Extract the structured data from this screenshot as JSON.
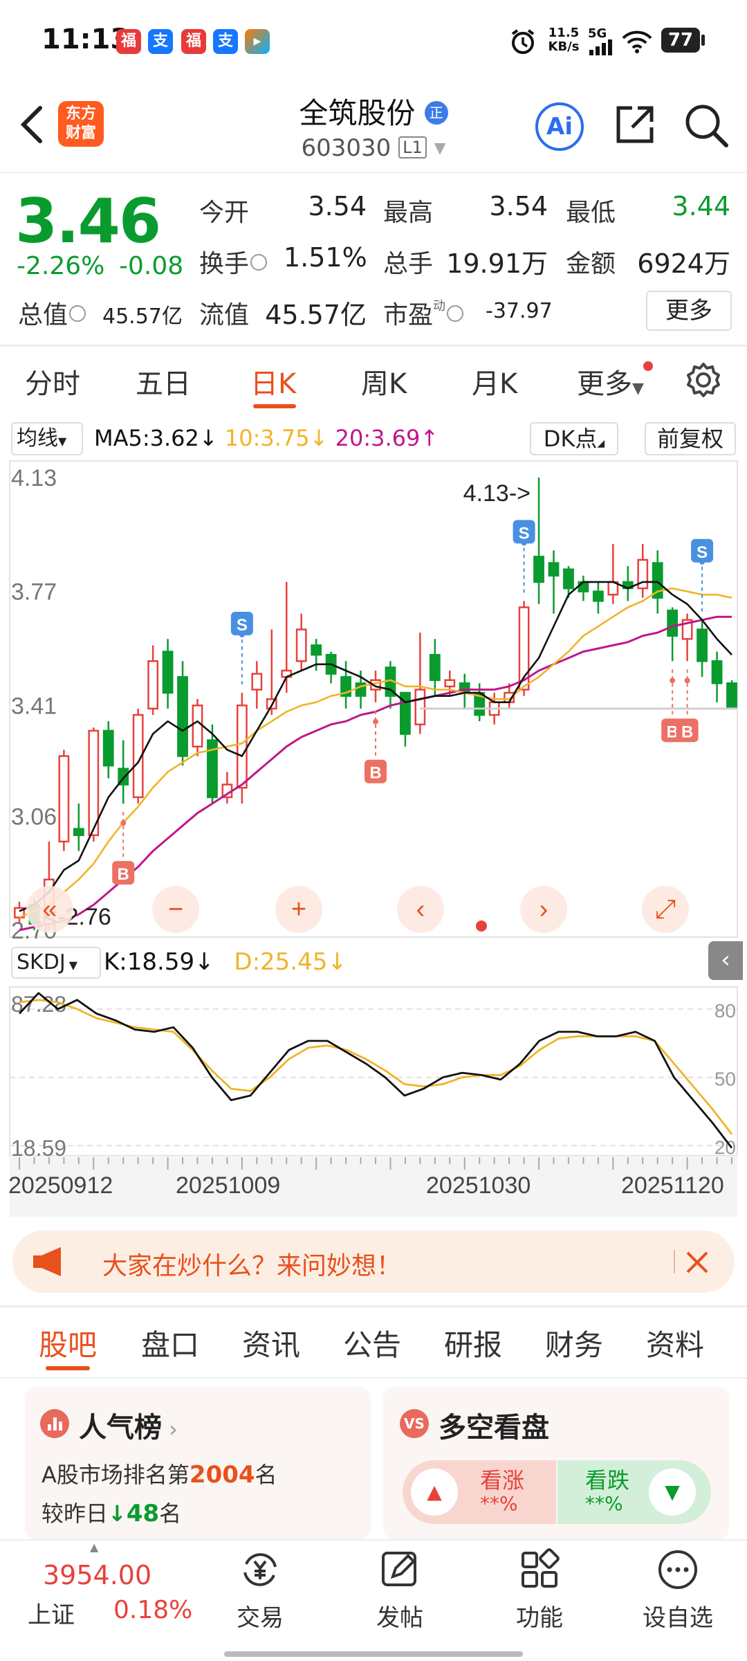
{
  "status_bar": {
    "time": "11:13",
    "net_speed_value": "11.5",
    "net_speed_unit": "KB/s",
    "network": "5G",
    "battery": "77"
  },
  "header": {
    "stock_name": "全筑股份",
    "name_badge": "正",
    "stock_code": "603030",
    "level_badge": "L1",
    "logo_line1": "东方",
    "logo_line2": "财富",
    "ai_label": "Ai"
  },
  "quote": {
    "price": "3.46",
    "change_pct": "-2.26%",
    "change_abs": "-0.08",
    "open_label": "今开",
    "open_value": "3.54",
    "high_label": "最高",
    "high_value": "3.54",
    "low_label": "最低",
    "low_value": "3.44",
    "turnover_label": "换手",
    "turnover_value": "1.51%",
    "volume_label": "总手",
    "volume_value": "19.91万",
    "amount_label": "金额",
    "amount_value": "6924万",
    "mktcap_label": "总值",
    "mktcap_value": "45.57亿",
    "float_label": "流值",
    "float_value": "45.57亿",
    "pe_label": "市盈",
    "pe_sup": "动",
    "pe_value": "-37.97",
    "more_label": "更多"
  },
  "period_tabs": {
    "items": [
      "分时",
      "五日",
      "日K",
      "周K",
      "月K",
      "更多"
    ],
    "active_index": 2
  },
  "kline_toolbar": {
    "indicator_select": "均线",
    "ma5": "MA5:3.62",
    "ma10": "10:3.75",
    "ma20": "20:3.69",
    "dk_label": "DK点",
    "adjust_label": "前复权"
  },
  "colors": {
    "up": "#e8413c",
    "down": "#0a9b2e",
    "accent": "#e8501c",
    "ma5": "#111111",
    "ma10": "#f0b429",
    "ma20": "#c0168c",
    "k_line": "#111111",
    "d_line": "#f0b429"
  },
  "chart_data": [
    {
      "type": "candlestick",
      "y_ticks": [
        "4.13",
        "3.77",
        "3.41",
        "3.06",
        "2.70"
      ],
      "ylim": [
        2.7,
        4.13
      ],
      "max_annotation": "4.13->",
      "min_annotation": "<-2.76",
      "candles": [
        [
          2.74,
          2.77,
          2.72,
          2.79
        ],
        [
          2.78,
          2.72,
          2.7,
          2.8
        ],
        [
          2.72,
          2.86,
          2.7,
          2.98
        ],
        [
          2.98,
          3.25,
          2.95,
          3.27
        ],
        [
          3.02,
          3.0,
          2.95,
          3.1
        ],
        [
          3.0,
          3.33,
          2.98,
          3.34
        ],
        [
          3.33,
          3.22,
          3.18,
          3.36
        ],
        [
          3.21,
          3.16,
          3.1,
          3.3
        ],
        [
          3.12,
          3.38,
          3.1,
          3.4
        ],
        [
          3.4,
          3.55,
          3.38,
          3.6
        ],
        [
          3.58,
          3.45,
          3.4,
          3.62
        ],
        [
          3.5,
          3.25,
          3.22,
          3.55
        ],
        [
          3.28,
          3.41,
          3.25,
          3.43
        ],
        [
          3.3,
          3.12,
          3.1,
          3.35
        ],
        [
          3.12,
          3.16,
          3.1,
          3.2
        ],
        [
          3.15,
          3.41,
          3.1,
          3.45
        ],
        [
          3.46,
          3.51,
          3.4,
          3.55
        ],
        [
          3.4,
          3.43,
          3.38,
          3.65
        ],
        [
          3.5,
          3.52,
          3.45,
          3.8
        ],
        [
          3.55,
          3.65,
          3.52,
          3.7
        ],
        [
          3.6,
          3.57,
          3.52,
          3.62
        ],
        [
          3.57,
          3.51,
          3.48,
          3.58
        ],
        [
          3.5,
          3.44,
          3.4,
          3.55
        ],
        [
          3.48,
          3.44,
          3.4,
          3.52
        ],
        [
          3.46,
          3.49,
          3.42,
          3.52
        ],
        [
          3.53,
          3.44,
          3.4,
          3.55
        ],
        [
          3.45,
          3.32,
          3.28,
          3.45
        ],
        [
          3.35,
          3.46,
          3.32,
          3.64
        ],
        [
          3.57,
          3.49,
          3.44,
          3.62
        ],
        [
          3.47,
          3.49,
          3.44,
          3.52
        ],
        [
          3.48,
          3.45,
          3.4,
          3.51
        ],
        [
          3.45,
          3.38,
          3.36,
          3.48
        ],
        [
          3.38,
          3.42,
          3.35,
          3.45
        ],
        [
          3.42,
          3.45,
          3.4,
          3.48
        ],
        [
          3.46,
          3.72,
          3.44,
          3.74
        ],
        [
          3.88,
          3.8,
          3.73,
          4.13
        ],
        [
          3.86,
          3.82,
          3.7,
          3.9
        ],
        [
          3.84,
          3.78,
          3.75,
          3.85
        ],
        [
          3.8,
          3.77,
          3.74,
          3.82
        ],
        [
          3.77,
          3.74,
          3.7,
          3.8
        ],
        [
          3.76,
          3.8,
          3.73,
          3.92
        ],
        [
          3.8,
          3.78,
          3.74,
          3.85
        ],
        [
          3.78,
          3.87,
          3.75,
          3.92
        ],
        [
          3.86,
          3.75,
          3.7,
          3.9
        ],
        [
          3.71,
          3.63,
          3.55,
          3.72
        ],
        [
          3.62,
          3.68,
          3.55,
          3.7
        ],
        [
          3.65,
          3.55,
          3.5,
          3.68
        ],
        [
          3.55,
          3.48,
          3.42,
          3.58
        ],
        [
          3.48,
          3.4,
          3.4,
          3.49
        ]
      ],
      "ma5": [
        2.76,
        2.78,
        2.82,
        2.89,
        2.92,
        3.02,
        3.12,
        3.18,
        3.23,
        3.32,
        3.36,
        3.33,
        3.36,
        3.32,
        3.27,
        3.25,
        3.33,
        3.41,
        3.5,
        3.52,
        3.54,
        3.54,
        3.52,
        3.5,
        3.47,
        3.46,
        3.42,
        3.43,
        3.44,
        3.44,
        3.45,
        3.45,
        3.42,
        3.42,
        3.5,
        3.56,
        3.66,
        3.76,
        3.8,
        3.8,
        3.8,
        3.78,
        3.8,
        3.8,
        3.76,
        3.73,
        3.68,
        3.62,
        3.57
      ],
      "ma10": [
        2.74,
        2.76,
        2.78,
        2.82,
        2.86,
        2.91,
        2.98,
        3.04,
        3.09,
        3.15,
        3.2,
        3.23,
        3.26,
        3.27,
        3.28,
        3.29,
        3.33,
        3.36,
        3.39,
        3.41,
        3.42,
        3.44,
        3.45,
        3.47,
        3.48,
        3.49,
        3.47,
        3.47,
        3.46,
        3.46,
        3.45,
        3.44,
        3.43,
        3.43,
        3.47,
        3.5,
        3.54,
        3.58,
        3.63,
        3.66,
        3.69,
        3.72,
        3.74,
        3.77,
        3.78,
        3.77,
        3.76,
        3.76,
        3.75
      ],
      "ma20": [
        2.7,
        2.71,
        2.72,
        2.73,
        2.75,
        2.78,
        2.82,
        2.86,
        2.9,
        2.95,
        2.99,
        3.03,
        3.07,
        3.1,
        3.13,
        3.16,
        3.2,
        3.24,
        3.28,
        3.31,
        3.33,
        3.35,
        3.36,
        3.38,
        3.39,
        3.41,
        3.42,
        3.43,
        3.44,
        3.45,
        3.46,
        3.46,
        3.46,
        3.47,
        3.49,
        3.52,
        3.54,
        3.56,
        3.58,
        3.59,
        3.6,
        3.61,
        3.63,
        3.64,
        3.66,
        3.67,
        3.68,
        3.69,
        3.69
      ]
    },
    {
      "type": "line",
      "indicator": "SKDJ",
      "k_label": "K:18.59",
      "d_label": "D:25.45",
      "y_ticks_left": [
        "87.28",
        "18.59"
      ],
      "y_ticks_right": [
        "80",
        "50",
        "20"
      ],
      "ylim": [
        18.59,
        87.28
      ],
      "x_ticks": [
        "20250912",
        "20251009",
        "20251030",
        "20251120"
      ],
      "series": [
        {
          "values": [
            78,
            87,
            80,
            84,
            78,
            75,
            71,
            70,
            72,
            63,
            50,
            40,
            42,
            52,
            62,
            66,
            66,
            61,
            56,
            50,
            42,
            45,
            50,
            52,
            51,
            49,
            56,
            66,
            70,
            70,
            68,
            68,
            70,
            66,
            50,
            40,
            30,
            19
          ]
        },
        {
          "values": [
            83,
            84,
            83,
            80,
            76,
            74,
            72,
            71,
            70,
            62,
            53,
            45,
            44,
            50,
            58,
            63,
            64,
            62,
            58,
            53,
            47,
            46,
            47,
            50,
            51,
            51,
            55,
            62,
            67,
            68,
            68,
            68,
            68,
            66,
            56,
            46,
            36,
            25
          ]
        }
      ]
    }
  ],
  "chart_controls": [
    "«",
    "−",
    "+",
    "‹",
    "›",
    "⤢"
  ],
  "banner": {
    "text": "大家在炒什么？来问妙想！"
  },
  "section_tabs": {
    "items": [
      "股吧",
      "盘口",
      "资讯",
      "公告",
      "研报",
      "财务",
      "资料"
    ],
    "active_index": 0
  },
  "popularity_card": {
    "title": "人气榜",
    "line1_prefix": "A股市场排名第",
    "rank": "2004",
    "line1_suffix": "名",
    "line2_prefix": "较昨日",
    "rank_change": "48",
    "line2_suffix": "名"
  },
  "sentiment_card": {
    "badge": "VS",
    "title": "多空看盘",
    "bull_label": "看涨",
    "bull_value": "**%",
    "bear_label": "看跌",
    "bear_value": "**%"
  },
  "bottom_nav": {
    "index_value": "3954.00",
    "index_name": "上证",
    "index_change": "0.18%",
    "items": [
      "交易",
      "发帖",
      "功能",
      "设自选"
    ]
  }
}
